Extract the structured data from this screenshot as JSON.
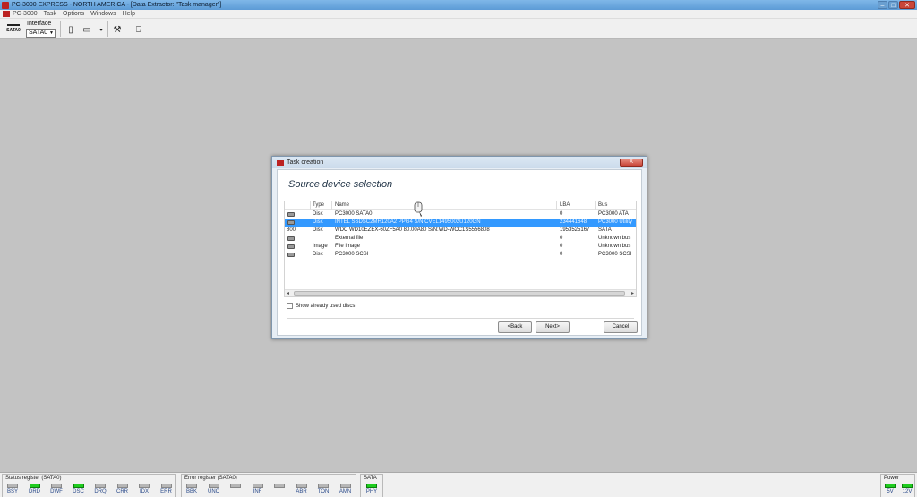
{
  "window": {
    "title": "PC-3000 EXPRESS - NORTH AMERICA - [Data Extractor: \"Task manager\"]",
    "icon": "app-logo"
  },
  "menu": [
    "PC-3000",
    "Task",
    "Options",
    "Windows",
    "Help"
  ],
  "toolbar": {
    "sata_label": "SATA0",
    "interface_label": "Interface",
    "interface_value": "SATA0"
  },
  "dialog": {
    "title": "Task creation",
    "heading": "Source device selection",
    "columns": [
      "Type",
      "Name",
      "LBA",
      "Bus"
    ],
    "rows": [
      {
        "prefix": "",
        "type": "Disk",
        "name": "PC3000 SATA0",
        "lba": "0",
        "bus": "PC3000 ATA",
        "icon": "disk-icon",
        "selected": false
      },
      {
        "prefix": "",
        "type": "Disk",
        "name": "INTEL SSDSC2MH120A2 PPG4 S/N:CVEL1495002U120GN",
        "lba": "234441648",
        "bus": "PC3000 Utility",
        "icon": "disk-icon",
        "selected": true
      },
      {
        "prefix": "800",
        "type": "Disk",
        "name": "WDC WD10EZEX-60ZF5A0 80.00A80 S/N:WD-WCC1S5556808",
        "lba": "1953525167",
        "bus": "SATA",
        "icon": "disk-icon",
        "selected": false
      },
      {
        "prefix": "",
        "type": "",
        "name": "External file",
        "lba": "0",
        "bus": "Unknown bus",
        "icon": "file-icon",
        "selected": false
      },
      {
        "prefix": "",
        "type": "Image",
        "name": "File Image",
        "lba": "0",
        "bus": "Unknown bus",
        "icon": "image-file-icon",
        "selected": false
      },
      {
        "prefix": "",
        "type": "Disk",
        "name": "PC3000 SCSI",
        "lba": "0",
        "bus": "PC3000 SCSI",
        "icon": "disk-icon",
        "selected": false
      }
    ],
    "checkbox_label": "Show already used discs",
    "checkbox_checked": false,
    "buttons": {
      "back": "<Back",
      "next": "Next>",
      "cancel": "Cancel"
    },
    "close_label": "X"
  },
  "status": {
    "status_register": {
      "title": "Status register (SATA0)",
      "leds": [
        {
          "label": "BSY",
          "on": false
        },
        {
          "label": "DRD",
          "on": true
        },
        {
          "label": "DWF",
          "on": false
        },
        {
          "label": "DSC",
          "on": true
        },
        {
          "label": "DRQ",
          "on": false
        },
        {
          "label": "CRR",
          "on": false
        },
        {
          "label": "IDX",
          "on": false
        },
        {
          "label": "ERR",
          "on": false
        }
      ]
    },
    "error_register": {
      "title": "Error register (SATA0)",
      "leds": [
        {
          "label": "BBK",
          "on": false
        },
        {
          "label": "UNC",
          "on": false
        },
        {
          "label": "",
          "on": false
        },
        {
          "label": "INF",
          "on": false
        },
        {
          "label": "",
          "on": false
        },
        {
          "label": "ABR",
          "on": false
        },
        {
          "label": "TON",
          "on": false
        },
        {
          "label": "AMN",
          "on": false
        }
      ]
    },
    "sata": {
      "title": "SATA",
      "leds": [
        {
          "label": "PHY",
          "on": true
        }
      ]
    },
    "power": {
      "title": "Power",
      "leds": [
        {
          "label": "5V",
          "on": true
        },
        {
          "label": "12V",
          "on": true
        }
      ]
    }
  },
  "colors": {
    "selection": "#3399ff",
    "led_on": "#1fcc1f",
    "led_off": "#b6b6b6",
    "desktop": "#c3c3c3"
  }
}
